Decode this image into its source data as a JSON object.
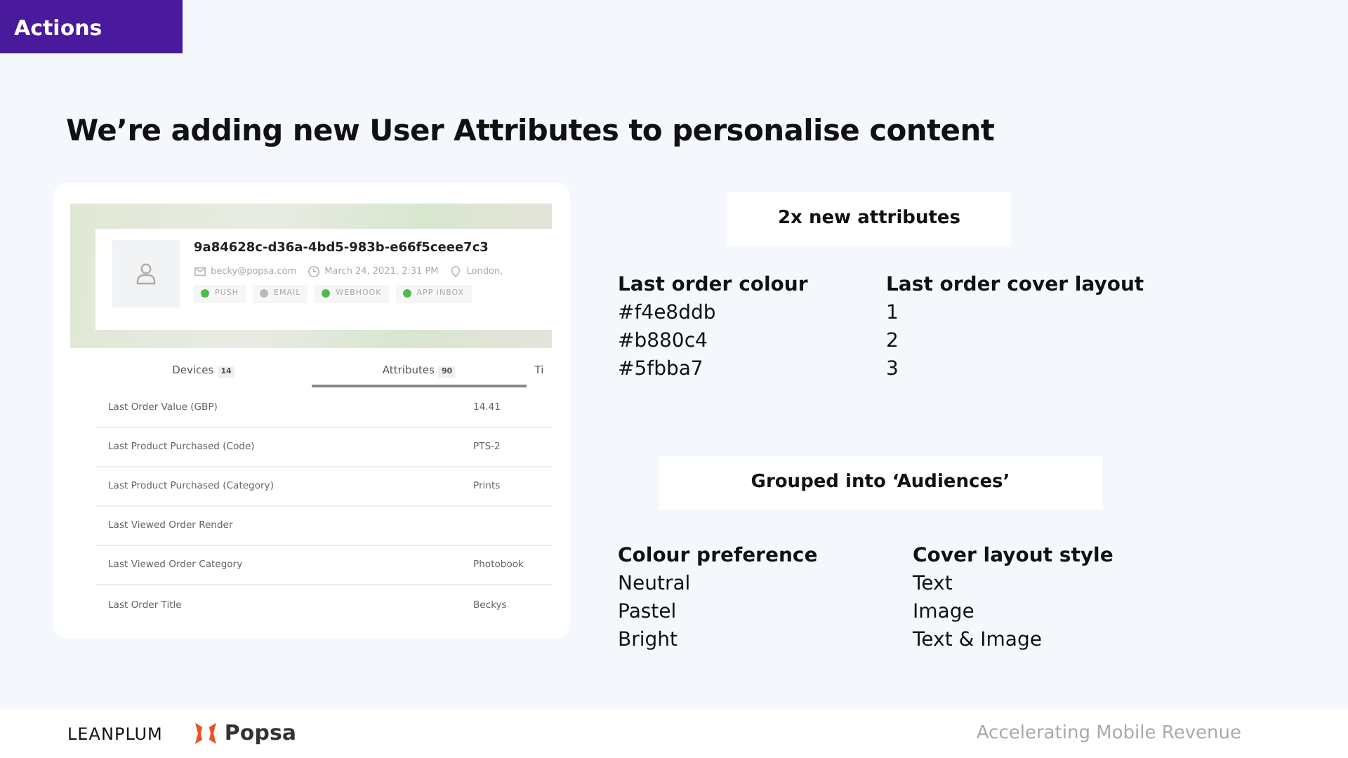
{
  "section_tag": "Actions",
  "title": "We’re adding new User Attributes to personalise content",
  "profile": {
    "user_id": "9a84628c-d36a-4bd5-983b-e66f5ceee7c3",
    "email": "becky@popsa.com",
    "date": "March 24, 2021, 2:31 PM",
    "location": "London,",
    "channels": [
      {
        "label": "PUSH",
        "on": true
      },
      {
        "label": "EMAIL",
        "on": false
      },
      {
        "label": "WEBHOOK",
        "on": true
      },
      {
        "label": "APP INBOX",
        "on": true
      }
    ],
    "tabs": [
      {
        "label": "Devices",
        "count": "14",
        "selected": false
      },
      {
        "label": "Attributes",
        "count": "90",
        "selected": true
      },
      {
        "label": "Ti",
        "selected": false
      }
    ],
    "attributes": [
      {
        "name": "Last Order Value (GBP)",
        "value": "14.41"
      },
      {
        "name": "Last Product Purchased (Code)",
        "value": "PTS-2"
      },
      {
        "name": "Last Product Purchased (Category)",
        "value": "Prints"
      },
      {
        "name": "Last Viewed Order Render"
      },
      {
        "name": "Last Viewed Order Category",
        "value": "Photobook"
      },
      {
        "name": "Last Order Title",
        "value": "Beckys"
      }
    ]
  },
  "panels": [
    {
      "heading": "2x new attributes",
      "columns": [
        {
          "title": "Last order colour",
          "items": [
            "#f4e8ddb",
            "#b880c4",
            "#5fbba7"
          ]
        },
        {
          "title": "Last order cover layout",
          "items": [
            "1",
            "2",
            "3"
          ]
        }
      ]
    },
    {
      "heading": "Grouped into ‘Audiences’",
      "columns": [
        {
          "title": "Colour preference",
          "items": [
            "Neutral",
            "Pastel",
            "Bright"
          ]
        },
        {
          "title": "Cover layout style",
          "items": [
            "Text",
            "Image",
            "Text & Image"
          ]
        }
      ]
    }
  ],
  "footer": {
    "logos": [
      "LEANPLUM",
      "Popsa"
    ],
    "tagline": "Accelerating Mobile Revenue"
  }
}
